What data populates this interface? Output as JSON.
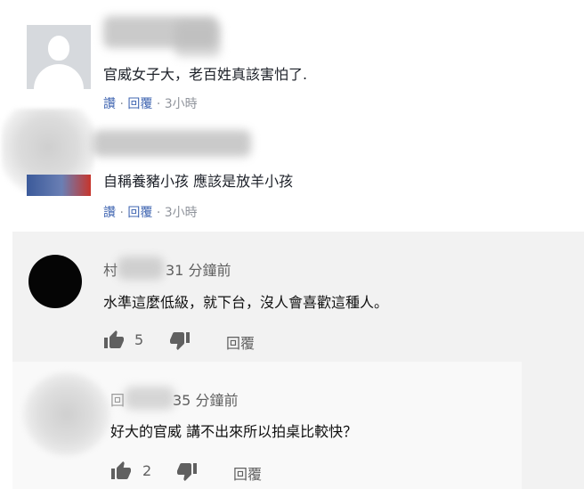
{
  "comments_fb": [
    {
      "text": "官威女子大，老百姓真該害怕了.",
      "like_label": "讚",
      "separator": "·",
      "reply_label": "回覆",
      "time": "3小時"
    },
    {
      "text": "自稱養豬小孩 應該是放羊小孩",
      "like_label": "讚",
      "separator": "·",
      "reply_label": "回覆",
      "time": "3小時"
    }
  ],
  "comments_yt": [
    {
      "name_visible": "村",
      "time": "31 分鐘前",
      "text": "水準這麼低級，就下台，沒人會喜歡這種人。",
      "likes": "5",
      "reply_label": "回覆"
    },
    {
      "name_visible": "回",
      "time": "35 分鐘前",
      "text": "好大的官威 講不出來所以拍桌比較快？",
      "likes": "2",
      "reply_label": "回覆"
    }
  ],
  "colors": {
    "fb_link": "#4267b2",
    "fb_meta_gray": "#90949c",
    "yt_gray": "#606060",
    "yt_panel": "#f2f2f2"
  },
  "icons": [
    "default-avatar-icon",
    "thumbs-up-icon",
    "thumbs-down-icon"
  ]
}
